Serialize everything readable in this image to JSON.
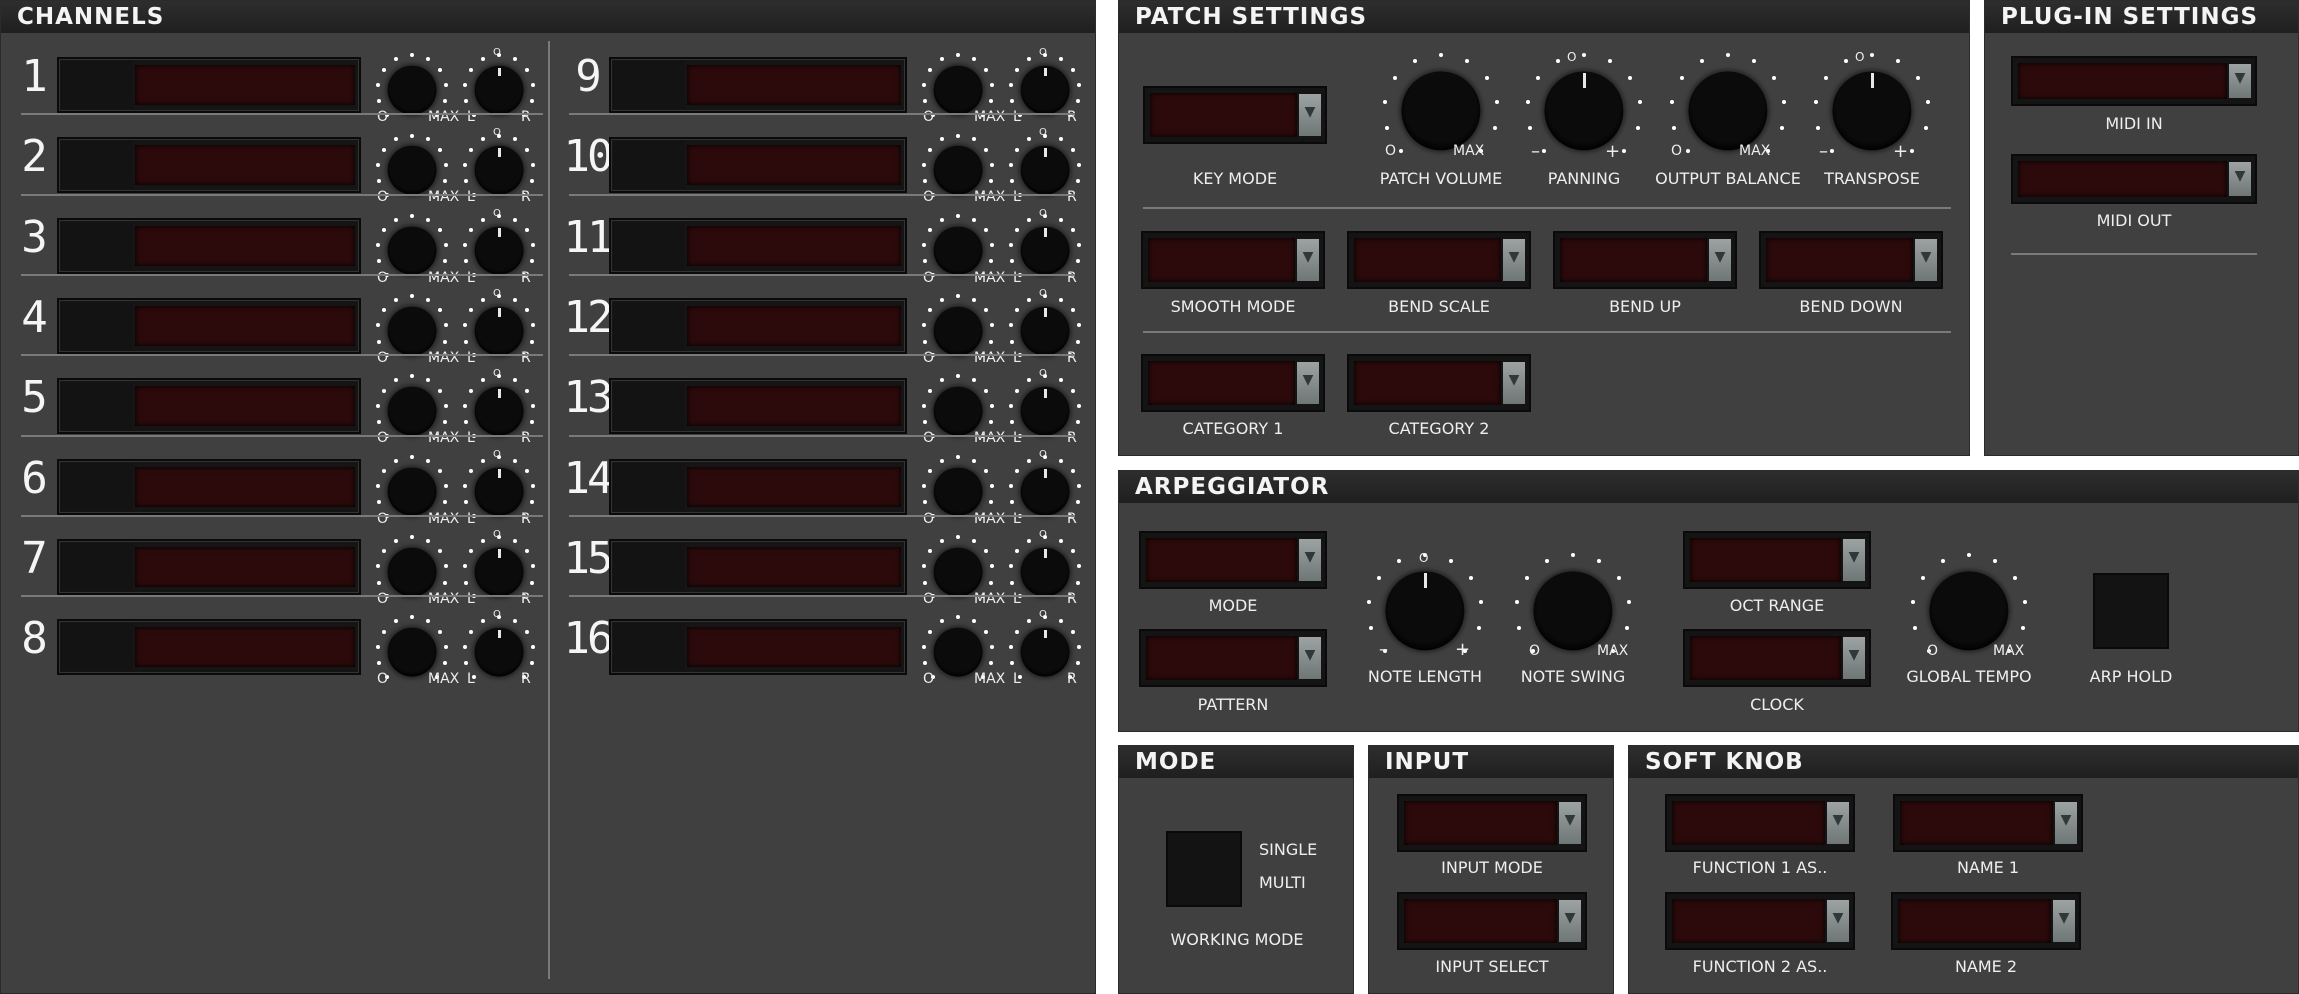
{
  "channels": {
    "title": "CHANNELS",
    "items": [
      {
        "num": "1"
      },
      {
        "num": "2"
      },
      {
        "num": "3"
      },
      {
        "num": "4"
      },
      {
        "num": "5"
      },
      {
        "num": "6"
      },
      {
        "num": "7"
      },
      {
        "num": "8"
      },
      {
        "num": "9"
      },
      {
        "num": "10"
      },
      {
        "num": "11"
      },
      {
        "num": "12"
      },
      {
        "num": "13"
      },
      {
        "num": "14"
      },
      {
        "num": "15"
      },
      {
        "num": "16"
      }
    ],
    "vol_min": "O",
    "vol_max": "MAX",
    "pan_left": "L",
    "pan_right": "R",
    "pan_center": "O"
  },
  "patch": {
    "title": "PATCH SETTINGS",
    "key_mode": "KEY MODE",
    "patch_volume": "PATCH VOLUME",
    "panning": "PANNING",
    "output_balance": "OUTPUT BALANCE",
    "transpose": "TRANSPOSE",
    "smooth_mode": "SMOOTH MODE",
    "bend_scale": "BEND SCALE",
    "bend_up": "BEND UP",
    "bend_down": "BEND DOWN",
    "category1": "CATEGORY 1",
    "category2": "CATEGORY 2",
    "min": "O",
    "max": "MAX",
    "minus": "–",
    "plus": "+",
    "center": "O"
  },
  "plugin": {
    "title": "PLUG-IN SETTINGS",
    "midi_in": "MIDI IN",
    "midi_out": "MIDI OUT"
  },
  "arp": {
    "title": "ARPEGGIATOR",
    "mode": "MODE",
    "pattern": "PATTERN",
    "note_length": "NOTE LENGTH",
    "note_swing": "NOTE SWING",
    "oct_range": "OCT RANGE",
    "clock": "CLOCK",
    "global_tempo": "GLOBAL TEMPO",
    "arp_hold": "ARP HOLD",
    "min": "O",
    "max": "MAX",
    "minus": "–",
    "plus": "+",
    "center": "O"
  },
  "mode": {
    "title": "MODE",
    "single": "SINGLE",
    "multi": "MULTI",
    "working_mode": "WORKING MODE"
  },
  "input": {
    "title": "INPUT",
    "input_mode": "INPUT MODE",
    "input_select": "INPUT SELECT"
  },
  "softknob": {
    "title": "SOFT KNOB",
    "function1": "FUNCTION 1 AS..",
    "name1": "NAME 1",
    "function2": "FUNCTION 2 AS..",
    "name2": "NAME 2"
  },
  "icons": {
    "dropdown": "chevron-down-icon"
  },
  "colors": {
    "panel": "#404040",
    "display_red": "#2c0a0b",
    "title_bar": "#1f1f1f"
  }
}
